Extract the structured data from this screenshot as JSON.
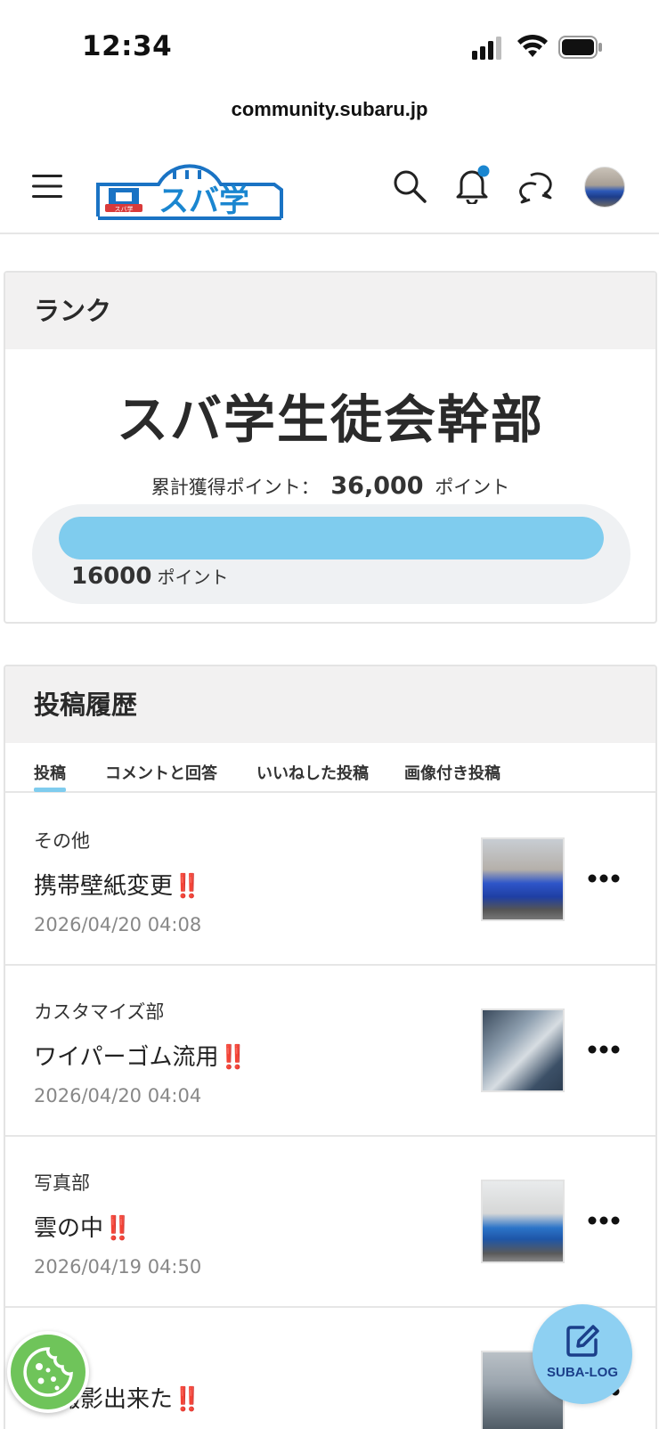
{
  "status_bar": {
    "time": "12:34"
  },
  "browser": {
    "url": "community.subaru.jp"
  },
  "header": {
    "logo_text": "スバ学",
    "logo_badge": "スバ学",
    "notification_dot_color": "#1a86d0"
  },
  "rank": {
    "header": "ランク",
    "title": "スバ学生徒会幹部",
    "points_label": "累計獲得ポイント：",
    "points_value": "36,000",
    "points_unit": "ポイント",
    "progress_value": "16000",
    "progress_unit": "ポイント",
    "progress_fraction": 1.0,
    "accent_color": "#7fccee"
  },
  "history": {
    "header": "投稿履歴",
    "tabs": [
      "投稿",
      "コメントと回答",
      "いいねした投稿",
      "画像付き投稿"
    ],
    "active_tab": 0,
    "posts": [
      {
        "category": "その他",
        "title": "携帯壁紙変更",
        "mark": "‼️",
        "date": "2026/04/20 04:08"
      },
      {
        "category": "カスタマイズ部",
        "title": "ワイパーゴム流用",
        "mark": "‼️",
        "date": "2026/04/20 04:04"
      },
      {
        "category": "写真部",
        "title": "雲の中",
        "mark": "‼️",
        "date": "2026/04/19 04:50"
      },
      {
        "category": "部",
        "title": "か撮影出来た",
        "mark": "‼️",
        "date": ""
      }
    ]
  },
  "fab": {
    "label": "SUBA-LOG",
    "icon": "edit-icon"
  },
  "cookie": {
    "icon": "cookie-icon"
  }
}
